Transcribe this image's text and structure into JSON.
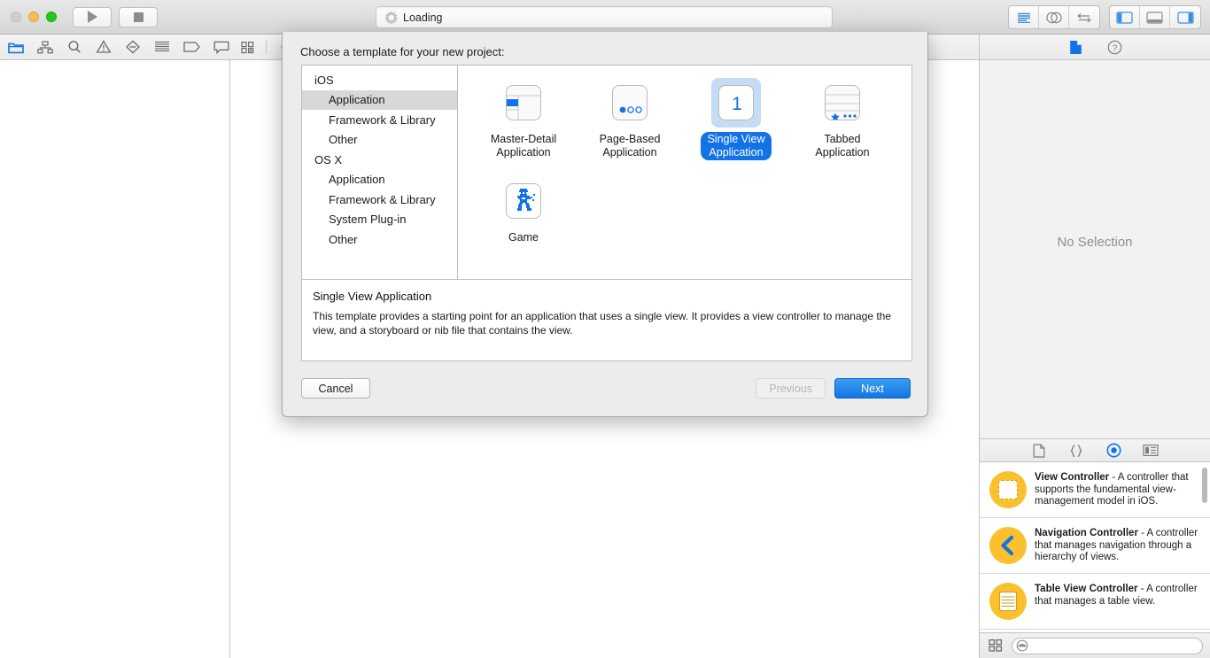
{
  "window": {
    "titlebar": {
      "traffic_lights": [
        "close",
        "minimize",
        "zoom"
      ],
      "run_button": "run-icon",
      "stop_button": "stop-icon",
      "status_text": "Loading",
      "status_icon": "spinner-icon",
      "right_group_1": [
        "standard-editor-icon",
        "assistant-editor-icon",
        "version-editor-icon"
      ],
      "right_group_2": [
        "toggle-navigator-icon",
        "toggle-debug-area-icon",
        "toggle-utilities-icon"
      ]
    },
    "navigator_toolbar": {
      "icons": [
        "project-navigator-icon",
        "symbol-navigator-icon",
        "find-navigator-icon",
        "issue-navigator-icon",
        "test-navigator-icon",
        "debug-navigator-icon",
        "breakpoint-navigator-icon",
        "report-navigator-icon"
      ]
    },
    "jump_bar": {
      "icons": [
        "related-items-icon",
        "back-chevron-icon"
      ]
    },
    "inspector": {
      "tabs": [
        "file-inspector-icon",
        "quick-help-inspector-icon"
      ],
      "active_tab": "file-inspector-icon",
      "empty_text": "No Selection"
    },
    "library": {
      "tabs": [
        "file-template-library-icon",
        "code-snippet-library-icon",
        "object-library-icon",
        "media-library-icon"
      ],
      "active_tab": "object-library-icon",
      "items": [
        {
          "icon": "view-controller-icon",
          "title": "View Controller",
          "description": " - A controller that supports the fundamental view-management model in iOS."
        },
        {
          "icon": "navigation-controller-icon",
          "title": "Navigation Controller",
          "description": " - A controller that manages navigation through a hierarchy of views."
        },
        {
          "icon": "table-view-controller-icon",
          "title": "Table View Controller",
          "description": " - A controller that manages a table view."
        }
      ],
      "bottom_bar": {
        "layout_icon": "grid-layout-icon",
        "search_icon": "filter-icon",
        "search_value": "",
        "search_placeholder": ""
      }
    }
  },
  "dialog": {
    "title": "Choose a template for your new project:",
    "categories": [
      {
        "label": "iOS",
        "type": "group",
        "selected": false
      },
      {
        "label": "Application",
        "type": "child",
        "selected": true
      },
      {
        "label": "Framework & Library",
        "type": "child",
        "selected": false
      },
      {
        "label": "Other",
        "type": "child",
        "selected": false
      },
      {
        "label": "OS X",
        "type": "group",
        "selected": false
      },
      {
        "label": "Application",
        "type": "child",
        "selected": false
      },
      {
        "label": "Framework & Library",
        "type": "child",
        "selected": false
      },
      {
        "label": "System Plug-in",
        "type": "child",
        "selected": false
      },
      {
        "label": "Other",
        "type": "child",
        "selected": false
      }
    ],
    "templates": [
      {
        "label": "Master-Detail\nApplication",
        "icon": "master-detail-icon",
        "selected": false
      },
      {
        "label": "Page-Based\nApplication",
        "icon": "page-based-icon",
        "selected": false
      },
      {
        "label": "Single View\nApplication",
        "icon": "single-view-icon",
        "selected": true
      },
      {
        "label": "Tabbed\nApplication",
        "icon": "tabbed-icon",
        "selected": false
      },
      {
        "label": "Game",
        "icon": "game-icon",
        "selected": false
      }
    ],
    "description": {
      "title": "Single View Application",
      "body": "This template provides a starting point for an application that uses a single view. It provides a view controller to manage the view, and a storyboard or nib file that contains the view."
    },
    "buttons": {
      "cancel": "Cancel",
      "previous": "Previous",
      "next": "Next"
    }
  },
  "colors": {
    "accent_blue": "#1273e6",
    "selection_tint": "#c5dcf5",
    "library_badge": "#fbc02d",
    "inactive_text": "#8e8e93"
  }
}
